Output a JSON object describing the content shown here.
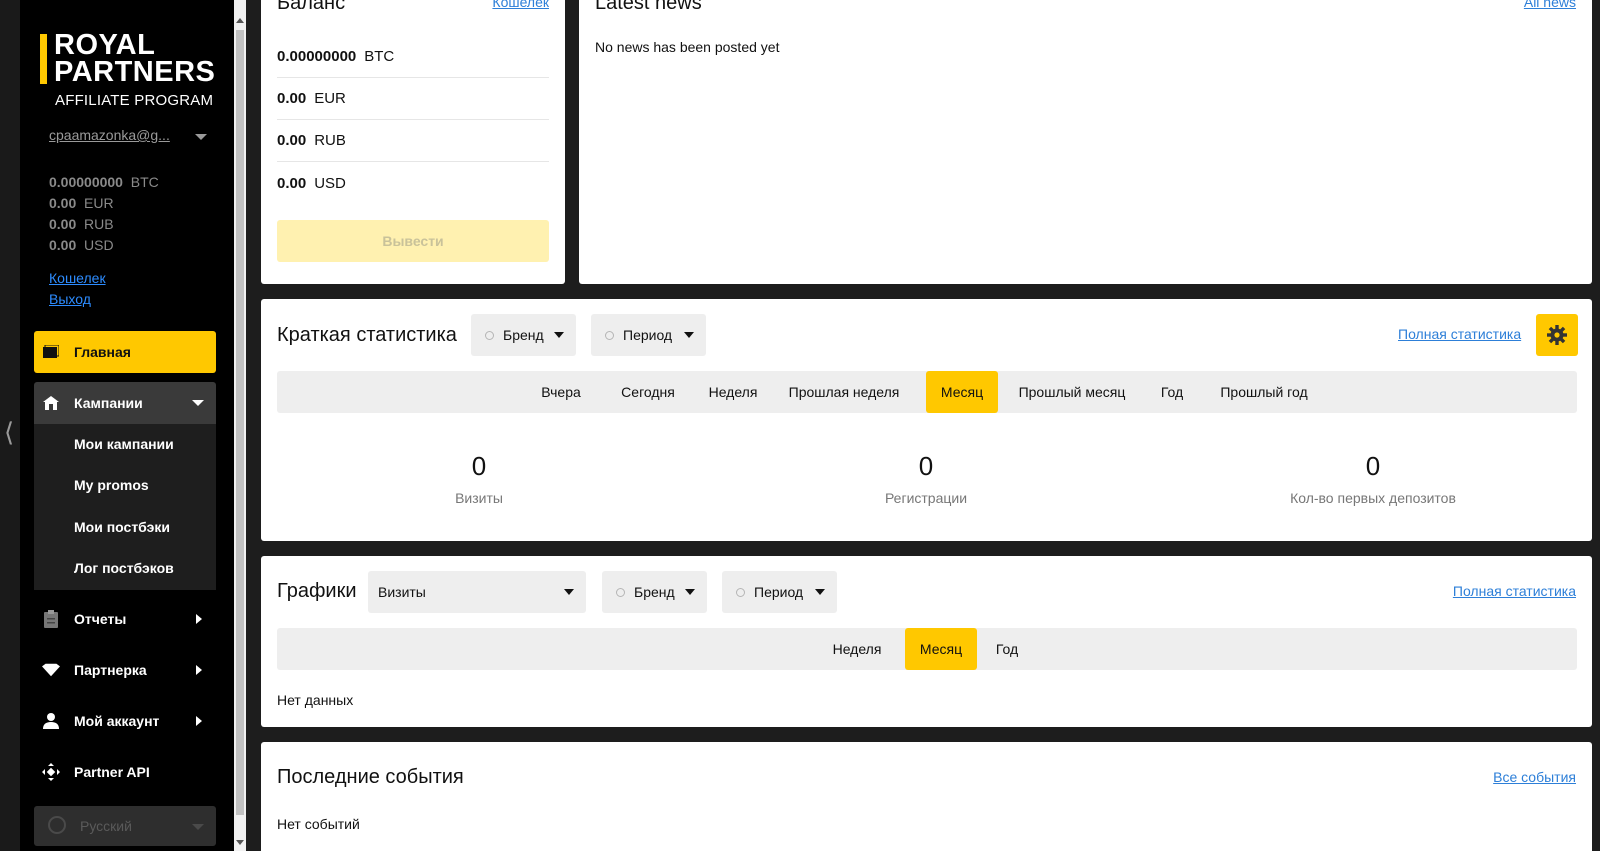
{
  "sidebar": {
    "logo": {
      "line1": "ROYAL",
      "line2": "PARTNERS",
      "line3": "AFFILIATE PROGRAM"
    },
    "user_email": "cpaamazonka@g...",
    "balances": [
      {
        "amount": "0.00000000",
        "currency": "BTC"
      },
      {
        "amount": "0.00",
        "currency": "EUR"
      },
      {
        "amount": "0.00",
        "currency": "RUB"
      },
      {
        "amount": "0.00",
        "currency": "USD"
      }
    ],
    "links": {
      "wallet": "Кошелек",
      "logout": "Выход"
    },
    "nav": {
      "home": "Главная",
      "campaigns": "Кампании",
      "sub": [
        "Мои кампании",
        "My promos",
        "Мои постбэки",
        "Лог постбэков"
      ],
      "reports": "Отчеты",
      "partner": "Партнерка",
      "account": "Мой аккаунт",
      "api": "Partner API"
    },
    "language": "Русский"
  },
  "balance_card": {
    "title": "Баланс",
    "link": "Кошелек",
    "rows": [
      {
        "amount": "0.00000000",
        "currency": "BTC"
      },
      {
        "amount": "0.00",
        "currency": "EUR"
      },
      {
        "amount": "0.00",
        "currency": "RUB"
      },
      {
        "amount": "0.00",
        "currency": "USD"
      }
    ],
    "withdraw_label": "Вывести"
  },
  "news_card": {
    "title": "Latest news",
    "link": "All news",
    "empty": "No news has been posted yet"
  },
  "quick_stats": {
    "title": "Краткая статистика",
    "brand": "Бренд",
    "period": "Период",
    "link": "Полная статистика",
    "tabs": [
      "Вчера",
      "Сегодня",
      "Неделя",
      "Прошлая неделя",
      "Месяц",
      "Прошлый месяц",
      "Год",
      "Прошлый год"
    ],
    "active_tab": "Месяц",
    "stats": [
      {
        "value": "0",
        "label": "Визиты"
      },
      {
        "value": "0",
        "label": "Регистрации"
      },
      {
        "value": "0",
        "label": "Кол-во первых депозитов"
      }
    ]
  },
  "charts": {
    "title": "Графики",
    "metric": "Визиты",
    "brand": "Бренд",
    "period": "Период",
    "link": "Полная статистика",
    "tabs": [
      "Неделя",
      "Месяц",
      "Год"
    ],
    "active_tab": "Месяц",
    "empty": "Нет данных"
  },
  "events": {
    "title": "Последние события",
    "link": "Все события",
    "empty": "Нет событий"
  },
  "colors": {
    "accent": "#ffc800",
    "link": "#2d7fd8",
    "sidebar_bg": "#000000",
    "page_bg": "#1d1d1d"
  }
}
